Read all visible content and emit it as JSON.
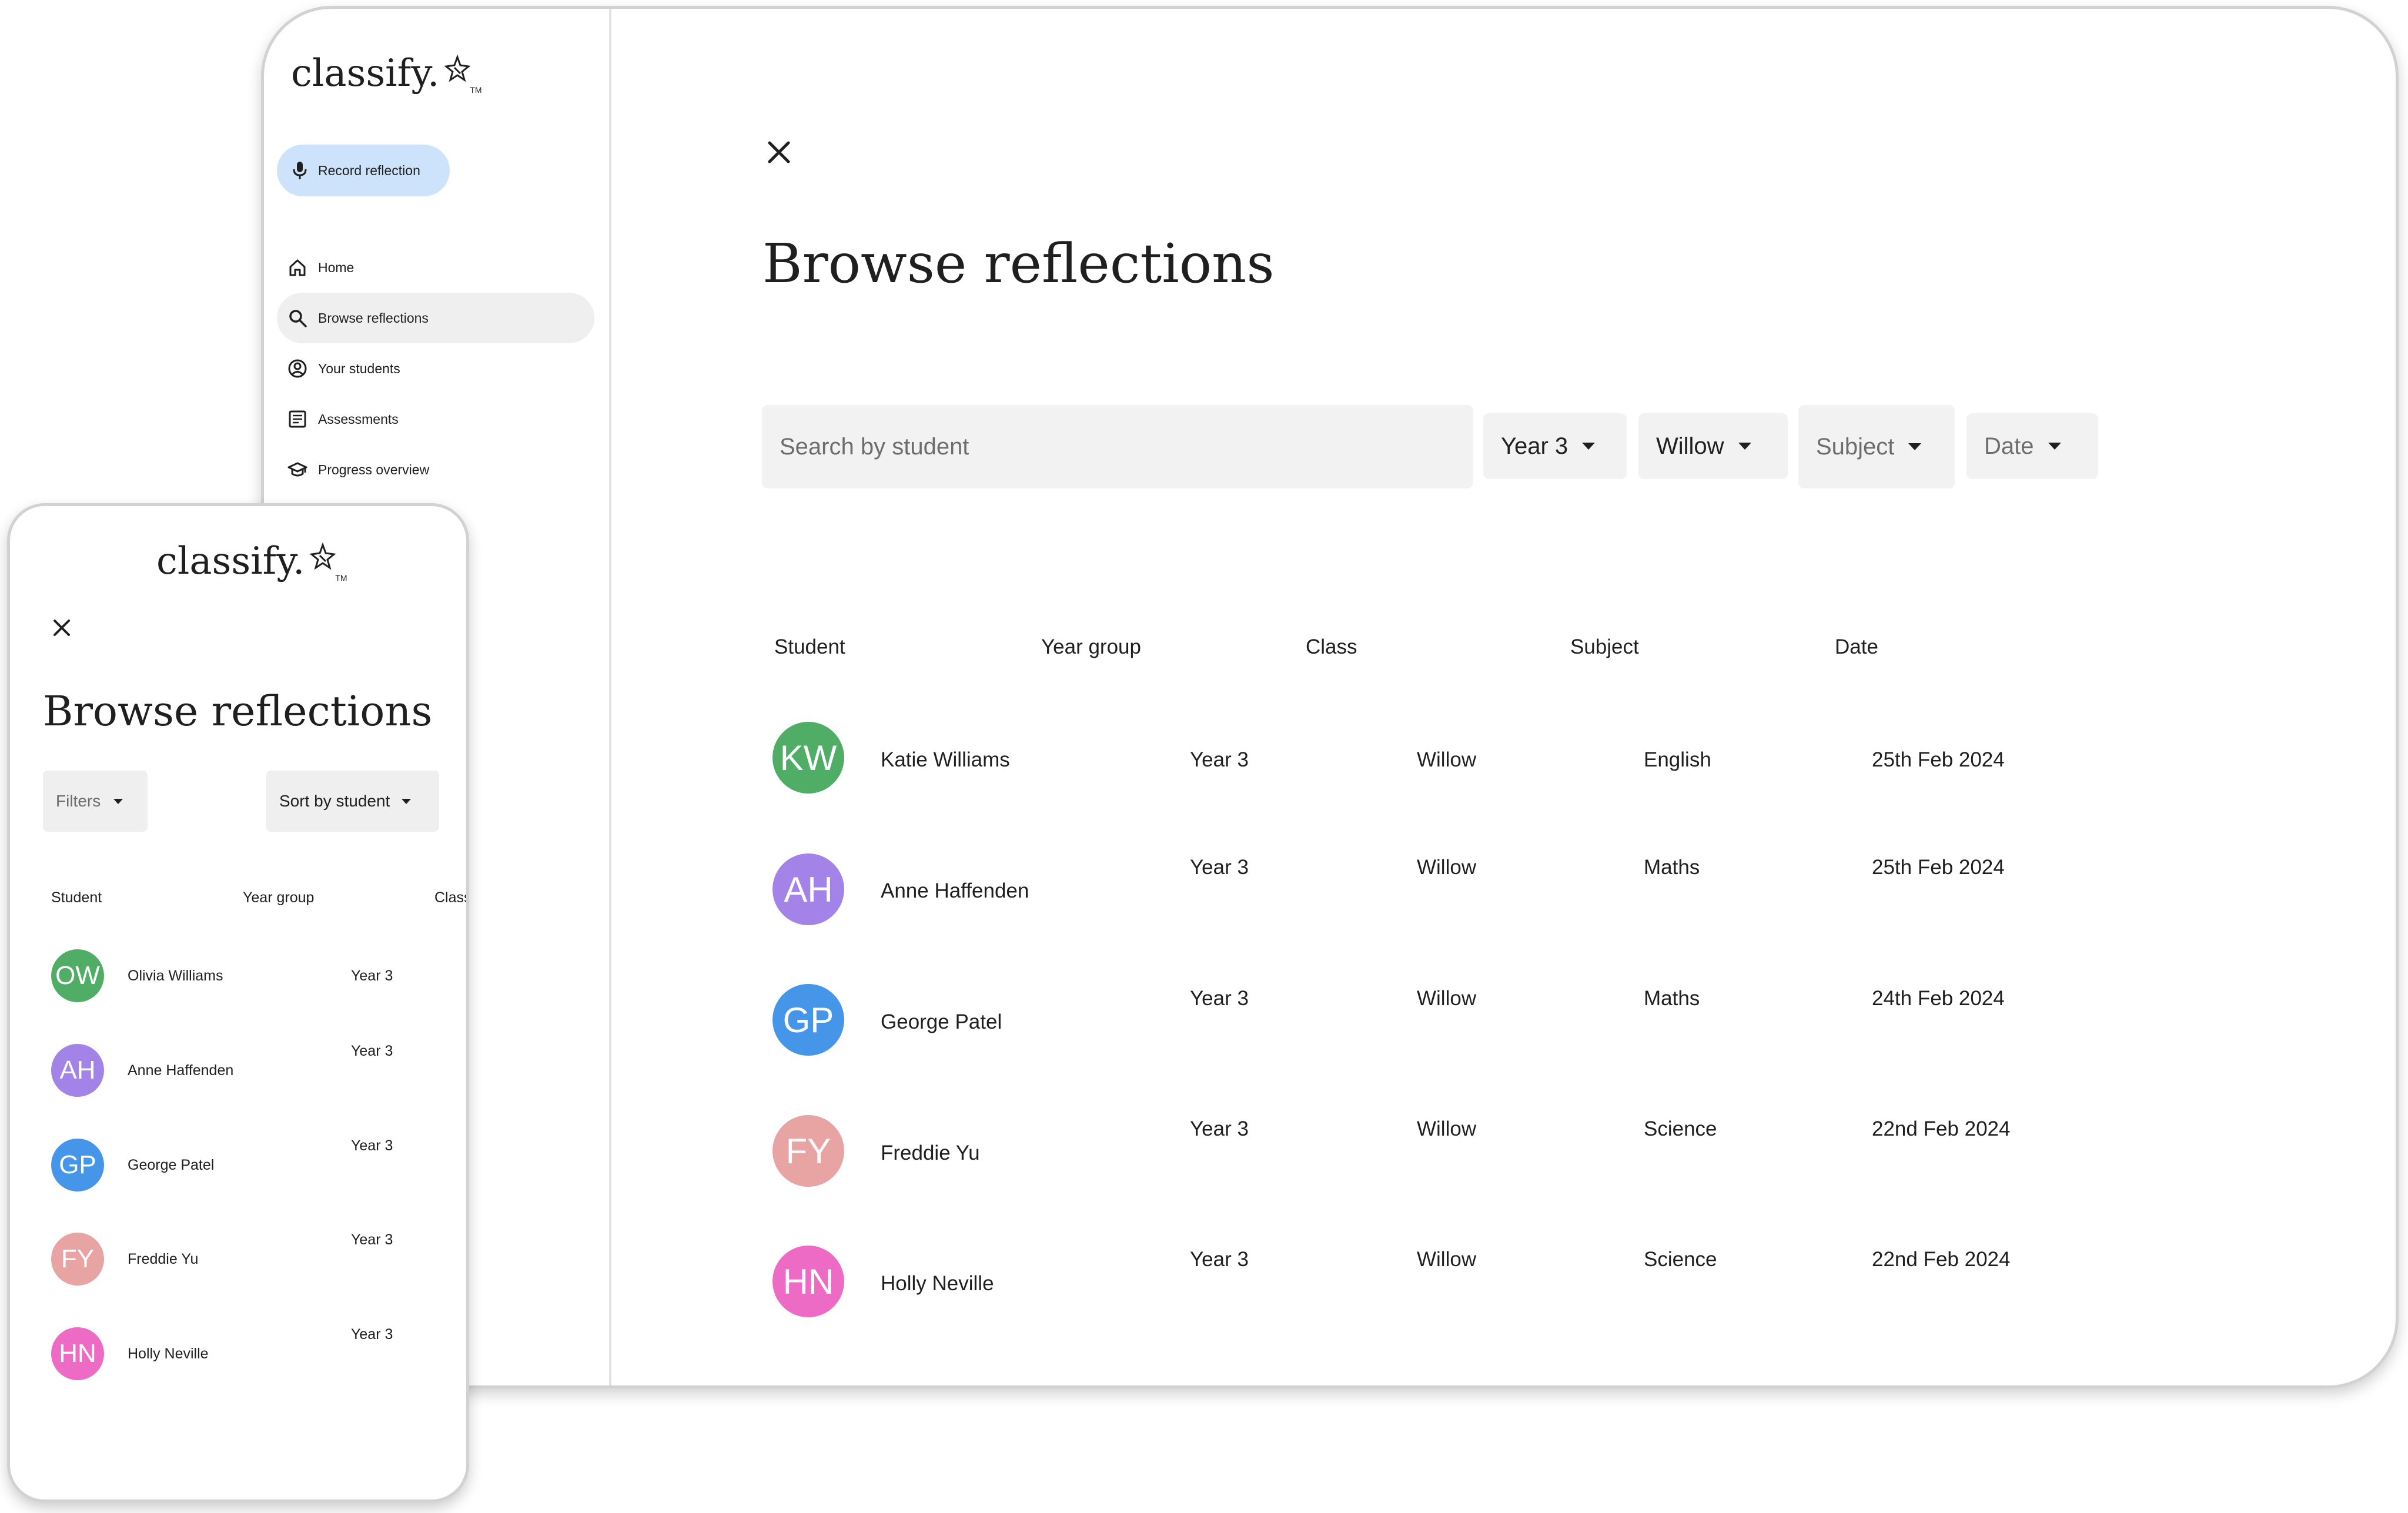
{
  "brand": {
    "name": "classify.",
    "tm": "TM"
  },
  "sidebar": {
    "record_button": "Record reflection",
    "items": [
      {
        "label": "Home",
        "icon": "home-icon"
      },
      {
        "label": "Browse reflections",
        "icon": "search-icon",
        "active": true
      },
      {
        "label": "Your students",
        "icon": "account-circle-icon"
      },
      {
        "label": "Assessments",
        "icon": "article-icon"
      },
      {
        "label": "Progress overview",
        "icon": "graduation-cap-icon"
      }
    ]
  },
  "desktop": {
    "title": "Browse reflections",
    "search_placeholder": "Search by student",
    "filters": [
      "Year 3",
      "Willow",
      "Subject",
      "Date"
    ],
    "columns": [
      "Student",
      "Year group",
      "Class",
      "Subject",
      "Date"
    ],
    "rows": [
      {
        "initials": "KW",
        "name": "Katie Williams",
        "year": "Year 3",
        "class": "Willow",
        "subject": "English",
        "date": "25th Feb 2024",
        "color": "#4fad66"
      },
      {
        "initials": "AH",
        "name": "Anne Haffenden",
        "year": "Year 3",
        "class": "Willow",
        "subject": "Maths",
        "date": "25th Feb 2024",
        "color": "#a383e8"
      },
      {
        "initials": "GP",
        "name": "George Patel",
        "year": "Year 3",
        "class": "Willow",
        "subject": "Maths",
        "date": "24th Feb 2024",
        "color": "#4596e8"
      },
      {
        "initials": "FY",
        "name": "Freddie Yu",
        "year": "Year 3",
        "class": "Willow",
        "subject": "Science",
        "date": "22nd Feb 2024",
        "color": "#e8a3a3"
      },
      {
        "initials": "HN",
        "name": "Holly Neville",
        "year": "Year 3",
        "class": "Willow",
        "subject": "Science",
        "date": "22nd Feb 2024",
        "color": "#ed6bc5"
      }
    ]
  },
  "mobile": {
    "title": "Browse reflections",
    "filters_label": "Filters",
    "sort_label": "Sort by student",
    "columns": [
      "Student",
      "Year group",
      "Class"
    ],
    "rows": [
      {
        "initials": "OW",
        "name": "Olivia Williams",
        "year": "Year 3",
        "color": "#4fad66"
      },
      {
        "initials": "AH",
        "name": "Anne Haffenden",
        "year": "Year 3",
        "color": "#a383e8"
      },
      {
        "initials": "GP",
        "name": "George Patel",
        "year": "Year 3",
        "color": "#4596e8"
      },
      {
        "initials": "FY",
        "name": "Freddie Yu",
        "year": "Year 3",
        "color": "#e8a3a3"
      },
      {
        "initials": "HN",
        "name": "Holly Neville",
        "year": "Year 3",
        "color": "#ed6bc5"
      }
    ]
  }
}
